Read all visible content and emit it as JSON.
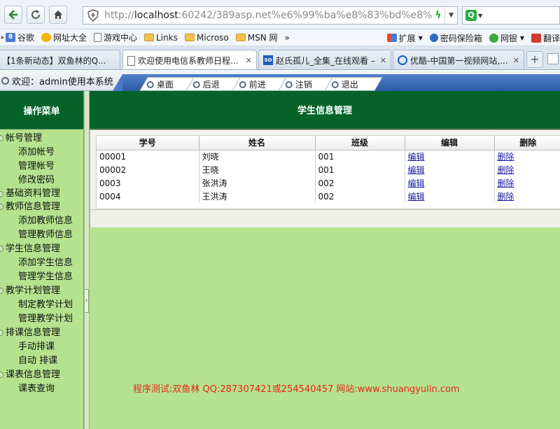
{
  "browser": {
    "url_prefix": "http://",
    "url_host": "localhost",
    "url_rest": ":60242/389asp.net%e6%99%ba%e8%83%bd%e8%",
    "bookmarks": [
      {
        "label": "谷歌",
        "icon": "google-icon"
      },
      {
        "label": "网址大全",
        "icon": "hao123-icon"
      },
      {
        "label": "游戏中心",
        "icon": "page-icon"
      },
      {
        "label": "Links",
        "icon": "folder-icon"
      },
      {
        "label": "Microso",
        "icon": "folder-icon"
      },
      {
        "label": "MSN 网",
        "icon": "folder-icon"
      }
    ],
    "bookmarks_overflow": "»",
    "bookmarks_right": [
      {
        "label": "扩展",
        "icon": "extension-icon"
      },
      {
        "label": "密码保险箱",
        "icon": "key-icon"
      },
      {
        "label": "网银",
        "icon": "bank-icon"
      },
      {
        "label": "翻译",
        "icon": "translate-icon"
      }
    ],
    "tabs": [
      {
        "title": "【1条新动态】双鱼林的Q...",
        "active": false
      },
      {
        "title": "欢迎使用电信系教师日程...",
        "active": true
      },
      {
        "title": "赵氏孤儿_全集_在线观看 –...",
        "active": false
      },
      {
        "title": "优酷-中国第一视频网站,...",
        "active": false
      }
    ],
    "new_tab": "+"
  },
  "app": {
    "welcome": "欢迎：admin使用本系统",
    "nav": [
      "桌面",
      "后退",
      "前进",
      "注销",
      "退出"
    ],
    "sidebar_title": "操作菜单",
    "menu": [
      {
        "group": "帐号管理",
        "items": [
          "添加帐号",
          "管理帐号",
          "修改密码"
        ]
      },
      {
        "group": "基础资料管理",
        "items": []
      },
      {
        "group": "教师信息管理",
        "items": [
          "添加教师信息",
          "管理教师信息"
        ]
      },
      {
        "group": "学生信息管理",
        "items": [
          "添加学生信息",
          "管理学生信息"
        ]
      },
      {
        "group": "教学计划管理",
        "items": [
          "制定教学计划",
          "管理教学计划"
        ]
      },
      {
        "group": "排课信息管理",
        "items": [
          "手动排课",
          "自动 排课"
        ]
      },
      {
        "group": "课表信息管理",
        "items": [
          "课表查询"
        ]
      }
    ],
    "page_title": "学生信息管理",
    "table": {
      "headers": [
        "学号",
        "姓名",
        "班级",
        "编辑",
        "删除"
      ],
      "rows": [
        [
          "00001",
          "刘晓",
          "001",
          "编辑",
          "删除"
        ],
        [
          "00002",
          "王晓",
          "001",
          "编辑",
          "删除"
        ],
        [
          "0003",
          "张洪涛",
          "002",
          "编辑",
          "删除"
        ],
        [
          "0004",
          "王洪涛",
          "002",
          "编辑",
          "删除"
        ]
      ]
    },
    "footer": "程序测试:双鱼林 QQ:287307421或254540457 网站:www.shuangyulin.com"
  },
  "colors": {
    "page_background": "#b5e28e",
    "header_green": "#05632a",
    "nav_band_blue": "#3a6bb8",
    "footer_red": "#e8231d",
    "link_blue": "#1a1aa6"
  }
}
